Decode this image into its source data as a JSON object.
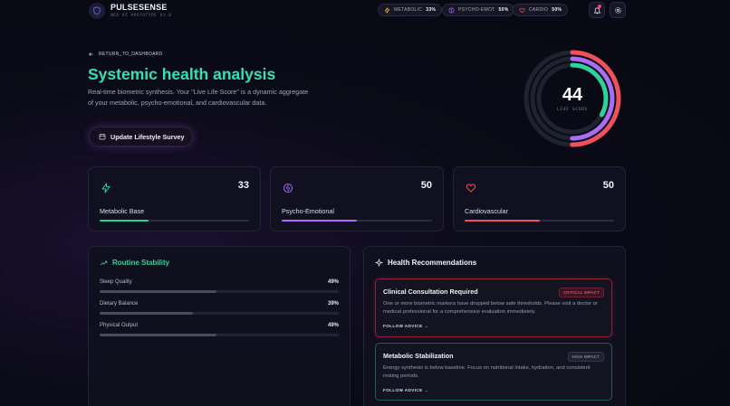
{
  "header": {
    "brand": "PULSESENSE",
    "subtitle": "NEO AI PROTOTYPE V1.0",
    "pills": [
      {
        "label": "METABOLIC",
        "value": "33%",
        "icon": "lightning-icon",
        "color": "#f5b83d"
      },
      {
        "label": "PSYCHO-EMOT",
        "value": "50%",
        "icon": "brain-icon",
        "color": "#a86cf5"
      },
      {
        "label": "CARDIO",
        "value": "50%",
        "icon": "heart-icon",
        "color": "#f0505a"
      }
    ],
    "icons": [
      "bell-icon",
      "gear-icon"
    ]
  },
  "hero": {
    "back_label": "RETURN_TO_DASHBOARD",
    "title": "Systemic health analysis",
    "description": "Real-time biometric synthesis. Your \"Live Life Score\" is a dynamic aggregate of your metabolic, psycho-emotional, and cardiovascular data.",
    "survey_button": "Update Lifestyle Survey"
  },
  "gauge": {
    "score": "44",
    "label": "LIVE SCORE",
    "rings": [
      {
        "name": "Cardiovascular",
        "value": 50,
        "color": "#f0505a"
      },
      {
        "name": "Psycho-Emotional",
        "value": 50,
        "color": "#a86cf5"
      },
      {
        "name": "Metabolic Base",
        "value": 33,
        "color": "#2bd39b"
      }
    ]
  },
  "metrics": [
    {
      "name": "Metabolic Base",
      "value": "33",
      "fill": 0.33,
      "color": "#2bd39b",
      "icon": "lightning-icon"
    },
    {
      "name": "Psycho-Emotional",
      "value": "50",
      "fill": 0.5,
      "color": "#a86cf5",
      "icon": "brain-icon"
    },
    {
      "name": "Cardiovascular",
      "value": "50",
      "fill": 0.5,
      "color": "#f0505a",
      "icon": "heart-icon"
    }
  ],
  "routine": {
    "title": "Routine Stability",
    "rows": [
      {
        "label": "Sleep Quality",
        "value": "49%",
        "fill": 0.49
      },
      {
        "label": "Dietary Balance",
        "value": "39%",
        "fill": 0.39
      },
      {
        "label": "Physical Output",
        "value": "49%",
        "fill": 0.49
      }
    ]
  },
  "recommendations": {
    "title": "Health Recommendations",
    "items": [
      {
        "title": "Clinical Consultation Required",
        "badge": "CRITICAL IMPACT",
        "body": "One or more biometric markers have dropped below safe thresholds. Please visit a doctor or medical professional for a comprehensive evaluation immediately.",
        "link": "FOLLOW ADVICE →",
        "accent": "#c8324a"
      },
      {
        "title": "Metabolic Stabilization",
        "badge": "HIGH IMPACT",
        "body": "Energy synthesis is below baseline. Focus on nutritional intake, hydration, and consistent resting periods.",
        "link": "FOLLOW ADVICE →",
        "accent": "#1f6e63"
      }
    ]
  }
}
